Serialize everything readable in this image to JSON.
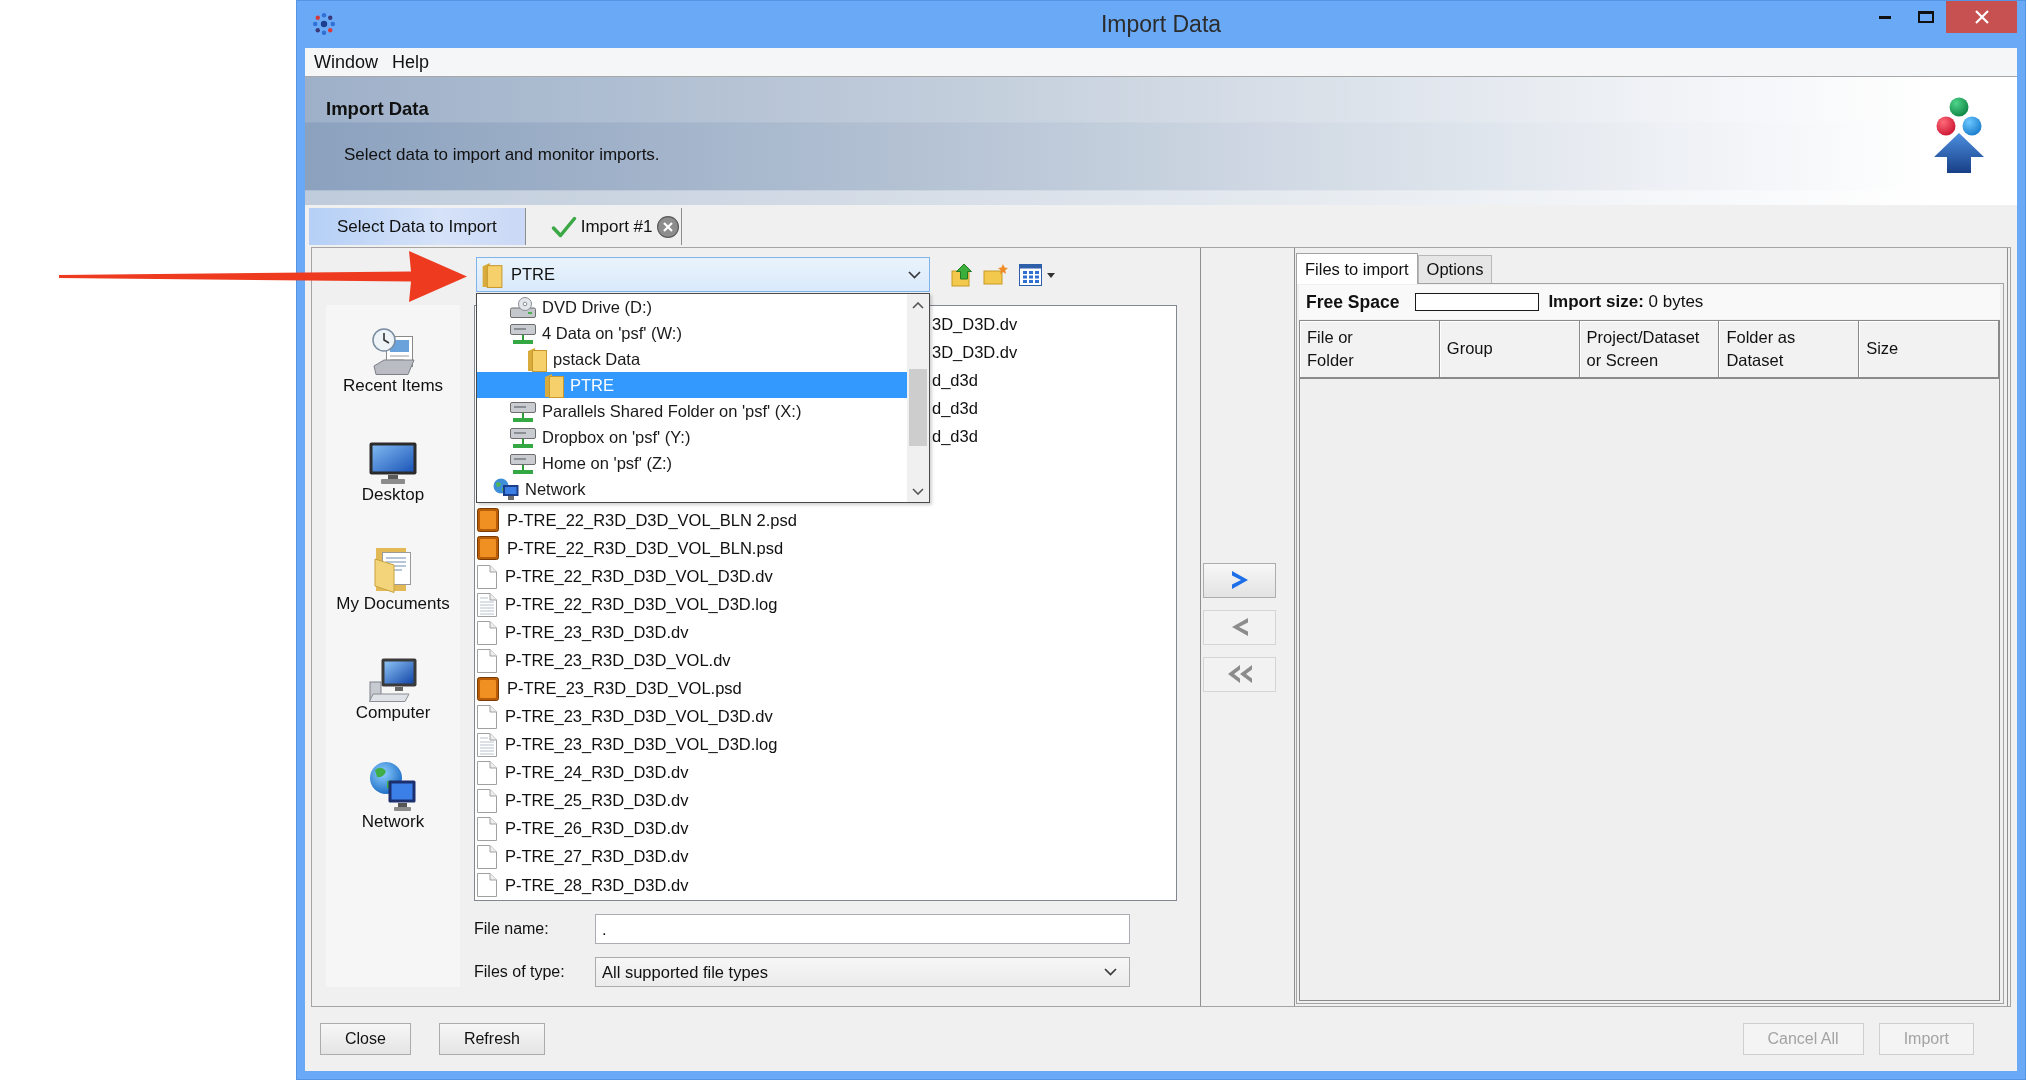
{
  "window": {
    "title": "Import Data"
  },
  "menu": [
    "Window",
    "Help"
  ],
  "header": {
    "title": "Import Data",
    "description": "Select data to import and monitor imports."
  },
  "tabs": [
    {
      "label": "Select Data to Import",
      "selected": true,
      "done": false,
      "closable": false
    },
    {
      "label": "Import #1",
      "selected": false,
      "done": true,
      "closable": true
    }
  ],
  "chooser": {
    "location": {
      "value": "PTRE",
      "expanded": true
    },
    "location_items": [
      {
        "children": [
          {
            "label": "DVD Drive (D:)",
            "kind": "dvd",
            "selected": false
          },
          {
            "label": "4 Data on 'psf' (W:)",
            "kind": "netdrive",
            "selected": false,
            "children": [
              {
                "label": "pstack Data",
                "kind": "folder",
                "selected": false,
                "children": [
                  {
                    "label": "PTRE",
                    "kind": "folder",
                    "selected": true
                  }
                ]
              }
            ]
          },
          {
            "label": "Parallels Shared Folder on 'psf' (X:)",
            "kind": "netdrive",
            "selected": false
          },
          {
            "label": "Dropbox on 'psf' (Y:)",
            "kind": "netdrive",
            "selected": false
          },
          {
            "label": "Home on 'psf' (Z:)",
            "kind": "netdrive",
            "selected": false
          }
        ]
      },
      {
        "label": "Network",
        "kind": "network",
        "selected": false
      }
    ],
    "places": [
      {
        "label": "Recent Items",
        "kind": "recent",
        "selected": false
      },
      {
        "label": "Desktop",
        "kind": "desktop",
        "selected": false
      },
      {
        "label": "My Documents",
        "kind": "documents",
        "selected": false
      },
      {
        "label": "Computer",
        "kind": "computer",
        "selected": false
      },
      {
        "label": "Network",
        "kind": "network",
        "selected": false
      }
    ],
    "files": [
      {
        "name": "3D_D3D.dv",
        "kind": "partial",
        "selected": false
      },
      {
        "name": "3D_D3D.dv",
        "kind": "partial",
        "selected": false
      },
      {
        "name": "d_d3d",
        "kind": "partial",
        "selected": false
      },
      {
        "name": "d_d3d",
        "kind": "partial",
        "selected": false
      },
      {
        "name": "d_d3d",
        "kind": "partial",
        "selected": false
      },
      {
        "name": "P-TRE_22_R3D_D3D_VOL_BLN 2.psd",
        "kind": "psd",
        "selected": false
      },
      {
        "name": "P-TRE_22_R3D_D3D_VOL_BLN.psd",
        "kind": "psd",
        "selected": false
      },
      {
        "name": "P-TRE_22_R3D_D3D_VOL_D3D.dv",
        "kind": "file",
        "selected": false
      },
      {
        "name": "P-TRE_22_R3D_D3D_VOL_D3D.log",
        "kind": "log",
        "selected": false
      },
      {
        "name": "P-TRE_23_R3D_D3D.dv",
        "kind": "file",
        "selected": false
      },
      {
        "name": "P-TRE_23_R3D_D3D_VOL.dv",
        "kind": "file",
        "selected": false
      },
      {
        "name": "P-TRE_23_R3D_D3D_VOL.psd",
        "kind": "psd",
        "selected": false
      },
      {
        "name": "P-TRE_23_R3D_D3D_VOL_D3D.dv",
        "kind": "file",
        "selected": false
      },
      {
        "name": "P-TRE_23_R3D_D3D_VOL_D3D.log",
        "kind": "log",
        "selected": false
      },
      {
        "name": "P-TRE_24_R3D_D3D.dv",
        "kind": "file",
        "selected": false
      },
      {
        "name": "P-TRE_25_R3D_D3D.dv",
        "kind": "file",
        "selected": false
      },
      {
        "name": "P-TRE_26_R3D_D3D.dv",
        "kind": "file",
        "selected": false
      },
      {
        "name": "P-TRE_27_R3D_D3D.dv",
        "kind": "file",
        "selected": false
      },
      {
        "name": "P-TRE_28_R3D_D3D.dv",
        "kind": "file",
        "selected": false
      }
    ],
    "file_name": {
      "label": "File name:",
      "value": "."
    },
    "file_type": {
      "label": "Files of type:",
      "value": "All supported file types"
    }
  },
  "transfer_buttons": [
    {
      "kind": "add",
      "disabled": false
    },
    {
      "kind": "remove",
      "disabled": true
    },
    {
      "kind": "remove_all",
      "disabled": true
    }
  ],
  "import_panel": {
    "tabs": [
      {
        "label": "Files to import",
        "selected": true
      },
      {
        "label": "Options",
        "selected": false
      }
    ],
    "free_space": {
      "label": "Free Space",
      "level": 0
    },
    "import_size": "**Import size:** 0 bytes",
    "columns": [
      "File or\nFolder",
      "Group",
      "Project/Dataset\nor Screen",
      "Folder as\nDataset",
      "Size"
    ]
  },
  "left_buttons": [
    {
      "label": "Close",
      "disabled": false
    },
    {
      "label": "Refresh",
      "disabled": false
    }
  ],
  "right_buttons": [
    {
      "label": "Cancel All",
      "disabled": true
    },
    {
      "label": "Import",
      "disabled": true
    }
  ]
}
